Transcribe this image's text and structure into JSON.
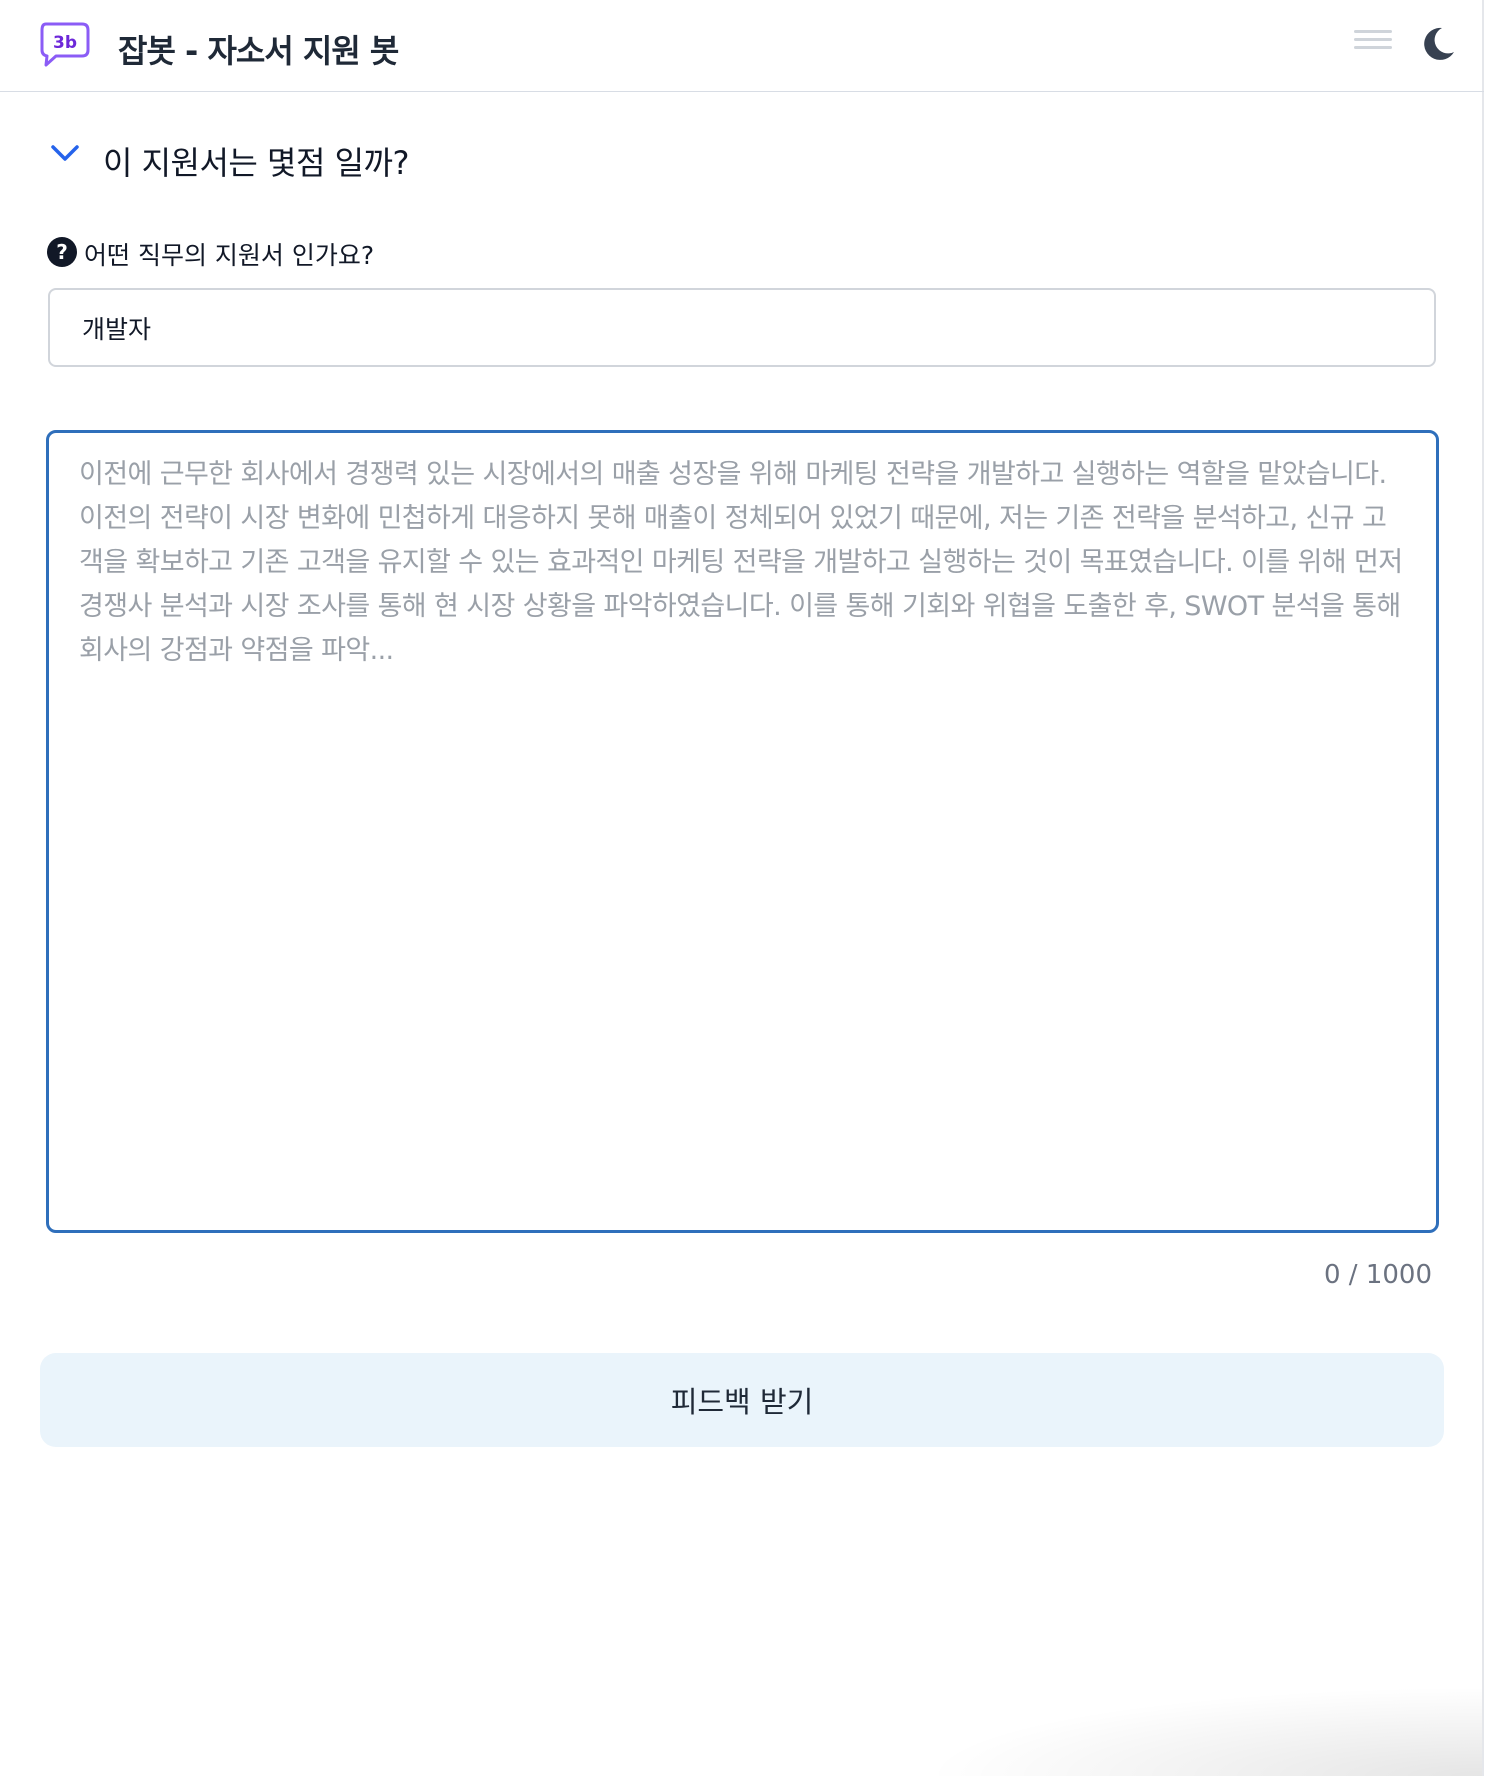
{
  "header": {
    "title": "잡봇 - 자소서 지원 봇",
    "logo_icon": "chat-bubble-logo-icon",
    "menu_icon": "hamburger-menu-icon",
    "theme_icon": "moon-icon"
  },
  "section": {
    "title": "이 지원서는 몇점 일까?",
    "toggle_icon": "chevron-down-icon"
  },
  "job_question": {
    "label": "어떤 직무의 지원서 인가요?",
    "help_icon": "question-circle-icon",
    "value": "개발자"
  },
  "essay": {
    "value": "",
    "placeholder": "이전에 근무한 회사에서 경쟁력 있는 시장에서의 매출 성장을 위해 마케팅 전략을 개발하고 실행하는 역할을 맡았습니다. 이전의 전략이 시장 변화에 민첩하게 대응하지 못해 매출이 정체되어 있었기 때문에, 저는 기존 전략을 분석하고, 신규 고객을 확보하고 기존 고객을 유지할 수 있는 효과적인 마케팅 전략을 개발하고 실행하는 것이 목표였습니다. 이를 위해 먼저 경쟁사 분석과 시장 조사를 통해 현 시장 상황을 파악하였습니다. 이를 통해 기회와 위협을 도출한 후, SWOT 분석을 통해 회사의 강점과 약점을 파악...",
    "char_count": "0 / 1000"
  },
  "submit": {
    "label": "피드백 받기"
  },
  "colors": {
    "accent_border": "#2f6fbb",
    "logo_purple": "#8b5cf6",
    "chevron_blue": "#2563eb",
    "button_bg": "#eaf4fb"
  }
}
